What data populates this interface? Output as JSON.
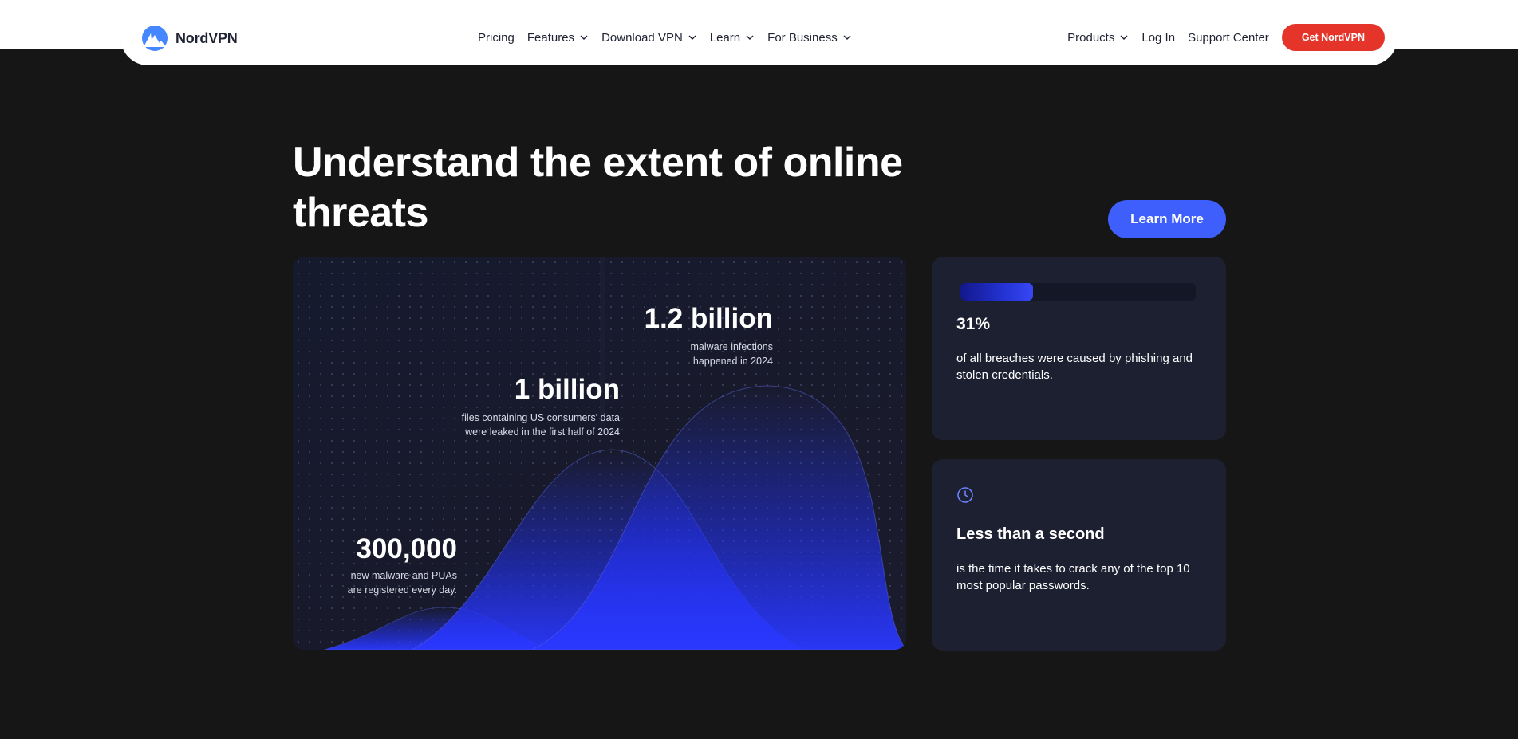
{
  "nav": {
    "logo_text": "NordVPN",
    "center_items": [
      {
        "label": "Pricing",
        "dropdown": false
      },
      {
        "label": "Features",
        "dropdown": true
      },
      {
        "label": "Download VPN",
        "dropdown": true
      },
      {
        "label": "Learn",
        "dropdown": true
      },
      {
        "label": "For Business",
        "dropdown": true
      }
    ],
    "products_label": "Products",
    "login_label": "Log In",
    "support_label": "Support Center",
    "cta_label": "Get NordVPN"
  },
  "hero": {
    "title": "Understand the extent of online threats",
    "learn_more_label": "Learn More"
  },
  "stats": [
    {
      "value": "300,000",
      "description": "new malware and PUAs\nare registered every day."
    },
    {
      "value": "1 billion",
      "description": "files containing US consumers' data\nwere leaked in the first half of 2024"
    },
    {
      "value": "1.2 billion",
      "description": "malware infections\nhappened in 2024"
    }
  ],
  "cards": {
    "phishing": {
      "percent": "31%",
      "progress_fraction": 0.31,
      "text": "of all breaches were caused by phishing and stolen credentials."
    },
    "password": {
      "icon": "clock-icon",
      "title": "Less than a second",
      "text": "is the time it takes to crack any of the top 10 most popular passwords."
    }
  },
  "colors": {
    "accent_blue": "#3e5ffc",
    "cta_red": "#e5342a",
    "page_bg": "#161616",
    "card_bg": "#1d2030"
  }
}
